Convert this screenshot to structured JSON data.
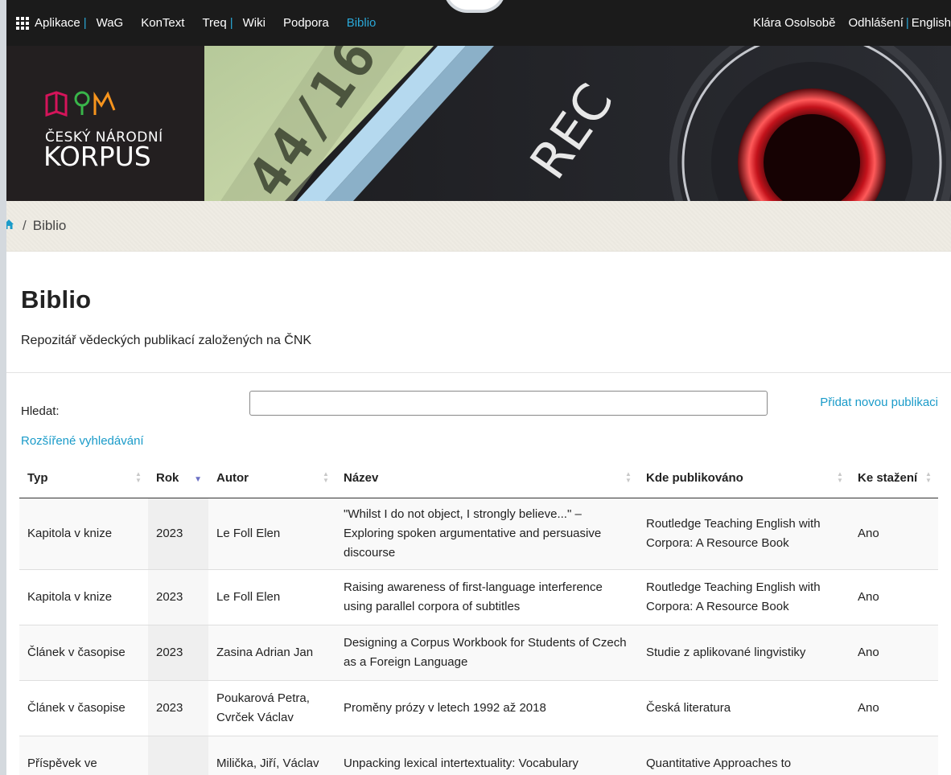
{
  "topnav": {
    "items": [
      {
        "label": "Aplikace",
        "sep_after": true
      },
      {
        "label": "WaG",
        "sep_after": false
      },
      {
        "label": "KonText",
        "sep_after": false
      },
      {
        "label": "Treq",
        "sep_after": true
      },
      {
        "label": "Wiki",
        "sep_after": false
      },
      {
        "label": "Podpora",
        "sep_after": false
      },
      {
        "label": "Biblio",
        "sep_after": false,
        "active": true
      }
    ],
    "separator": "|",
    "user": "Klára Osolsobě",
    "logout": "Odhlášení",
    "language": "English",
    "colors": {
      "bar": "#1b1b1b",
      "accent": "#2aa8d8"
    }
  },
  "banner": {
    "logo_line1": "ČESKÝ NÁRODNÍ",
    "logo_line2": "KORPUS",
    "display_digits": "44/16",
    "rec_label": "REC"
  },
  "breadcrumb": {
    "separator": "/",
    "current": "Biblio"
  },
  "page": {
    "title": "Biblio",
    "description": "Repozitář vědeckých publikací založených na ČNK"
  },
  "search": {
    "label": "Hledat:",
    "value": "",
    "placeholder": "",
    "add_link": "Přidat novou publikaci",
    "advanced_link": "Rozšířené vyhledávání"
  },
  "table": {
    "columns": [
      {
        "label": "Typ"
      },
      {
        "label": "Rok",
        "sorted": "desc"
      },
      {
        "label": "Autor"
      },
      {
        "label": "Název"
      },
      {
        "label": "Kde publikováno"
      },
      {
        "label": "Ke stažení"
      }
    ],
    "rows": [
      {
        "typ": "Kapitola v knize",
        "rok": "2023",
        "autor": "Le Foll Elen",
        "nazev": "\"Whilst I do not object, I strongly believe...\" – Exploring spoken argumentative and persuasive discourse",
        "kde": "Routledge Teaching English with Corpora: A Resource Book",
        "stazeni": "Ano"
      },
      {
        "typ": "Kapitola v knize",
        "rok": "2023",
        "autor": "Le Foll Elen",
        "nazev": "Raising awareness of first-language interference using parallel corpora of subtitles",
        "kde": "Routledge Teaching English with Corpora: A Resource Book",
        "stazeni": "Ano"
      },
      {
        "typ": "Článek v časopise",
        "rok": "2023",
        "autor": "Zasina Adrian Jan",
        "nazev": "Designing a Corpus Workbook for Students of Czech as a Foreign Language",
        "kde": "Studie z aplikované lingvistiky",
        "stazeni": "Ano"
      },
      {
        "typ": "Článek v časopise",
        "rok": "2023",
        "autor": "Poukarová Petra, Cvrček Václav",
        "nazev": "Proměny prózy v letech 1992 až 2018",
        "kde": "Česká literatura",
        "stazeni": "Ano"
      },
      {
        "typ": "Příspěvek ve",
        "rok": "",
        "autor": "Milička, Jiří, Václav",
        "nazev": "Unpacking lexical intertextuality: Vocabulary",
        "kde": "Quantitative Approaches to",
        "stazeni": ""
      }
    ]
  }
}
